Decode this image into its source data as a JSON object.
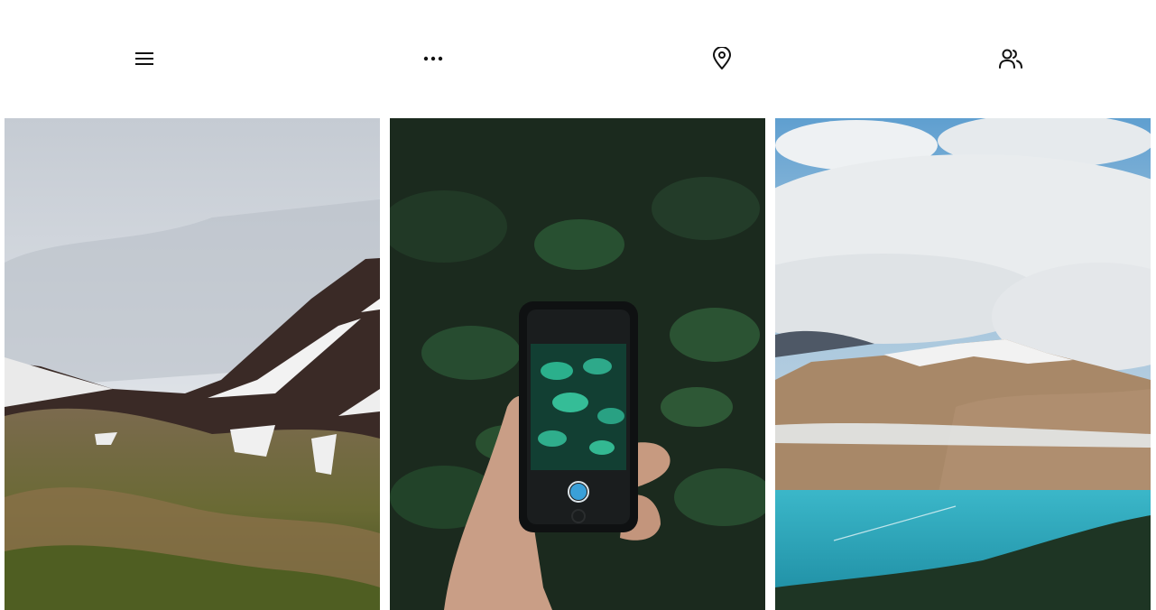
{
  "nav": {
    "items": [
      {
        "icon": "menu-icon"
      },
      {
        "icon": "more-horizontal-icon"
      },
      {
        "icon": "map-pin-icon"
      },
      {
        "icon": "users-icon"
      }
    ]
  },
  "gallery": {
    "photos": [
      {
        "subject": "mountain-snow-landscape"
      },
      {
        "subject": "hand-phone-leaves"
      },
      {
        "subject": "lake-mountain-clouds"
      }
    ]
  },
  "colors": {
    "icon": "#111111",
    "sky_grey": "#cdd2d9",
    "forest_dark": "#1d2a1f",
    "sky_blue": "#6ea8d4",
    "lake_teal": "#2fa4b8"
  }
}
